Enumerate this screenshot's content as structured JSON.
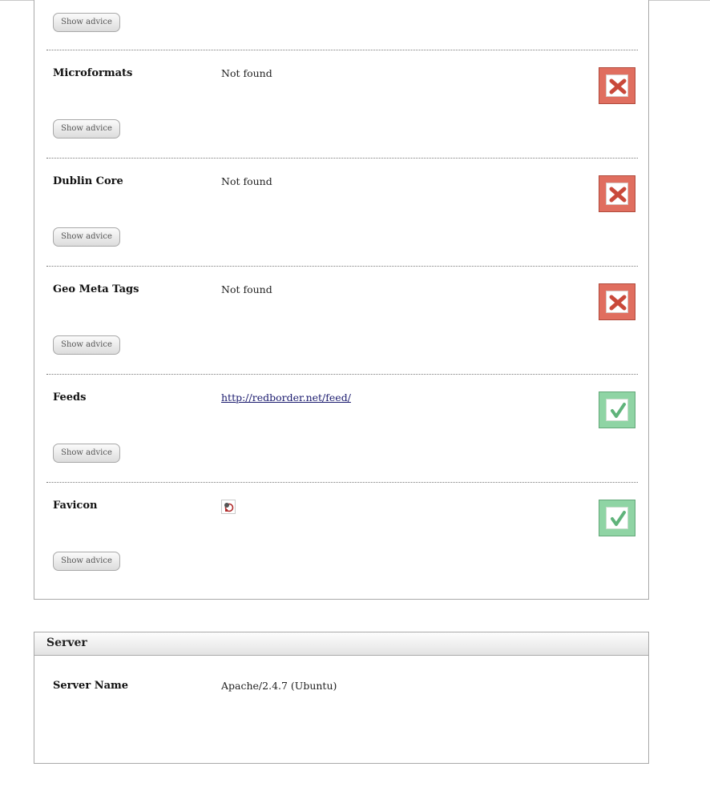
{
  "advice_label": "Show advice",
  "checks": [
    {
      "label": "Microformats",
      "value": "Not found",
      "status": "fail",
      "status_icon": "cross-icon"
    },
    {
      "label": "Dublin Core",
      "value": "Not found",
      "status": "fail",
      "status_icon": "cross-icon"
    },
    {
      "label": "Geo Meta Tags",
      "value": "Not found",
      "status": "fail",
      "status_icon": "cross-icon"
    },
    {
      "label": "Feeds",
      "value": "http://redborder.net/feed/",
      "status": "pass",
      "status_icon": "check-icon"
    },
    {
      "label": "Favicon",
      "value_icon": "favicon-icon",
      "status": "pass",
      "status_icon": "check-icon"
    }
  ],
  "server": {
    "title": "Server",
    "rows": [
      {
        "label": "Server Name",
        "value": "Apache/2.4.7 (Ubuntu)"
      }
    ]
  },
  "colors": {
    "fail": "#e06e5f",
    "pass": "#8fd4a4"
  }
}
